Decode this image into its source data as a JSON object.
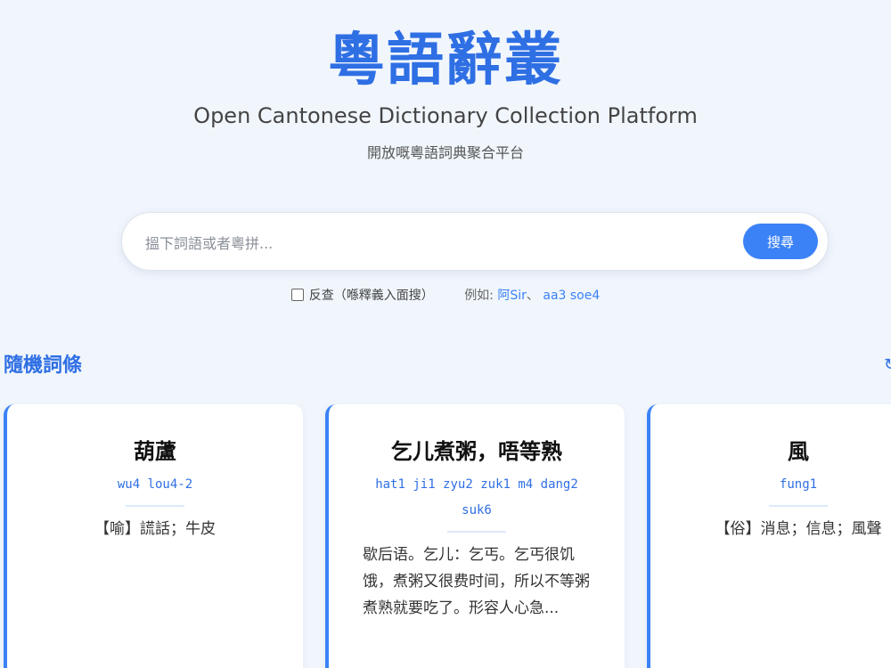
{
  "header": {
    "logo": "粵語辭叢",
    "subtitle_en": "Open Cantonese Dictionary Collection Platform",
    "subtitle_zh": "開放嘅粵語詞典聚合平台"
  },
  "search": {
    "placeholder": "搵下詞語或者粵拼...",
    "value": "",
    "button_label": "搜尋"
  },
  "options": {
    "reverse_label": "反查（喺釋義入面搜）",
    "reverse_checked": false,
    "examples_label": "例如:",
    "examples": [
      "阿Sir",
      "aa3 soe4"
    ],
    "example_separator": "、"
  },
  "random_section": {
    "title": "隨機詞條",
    "refresh_icon": "refresh-icon",
    "cards": [
      {
        "headword": "葫蘆",
        "jyutping": "wu4 lou4-2",
        "definition": "【喻】謊話；牛皮"
      },
      {
        "headword": "乞儿煮粥，唔等熟",
        "jyutping": "hat1 ji1 zyu2 zuk1 m4 dang2 suk6",
        "definition": "歇后语。乞儿：乞丐。乞丐很饥饿，煮粥又很费时间，所以不等粥煮熟就要吃了。形容人心急..."
      },
      {
        "headword": "風",
        "jyutping": "fung1",
        "definition": "【俗】消息；信息；風聲"
      }
    ]
  },
  "colors": {
    "accent": "#2f6fe4",
    "button": "#3b82f6",
    "background": "#f1f6fd"
  }
}
